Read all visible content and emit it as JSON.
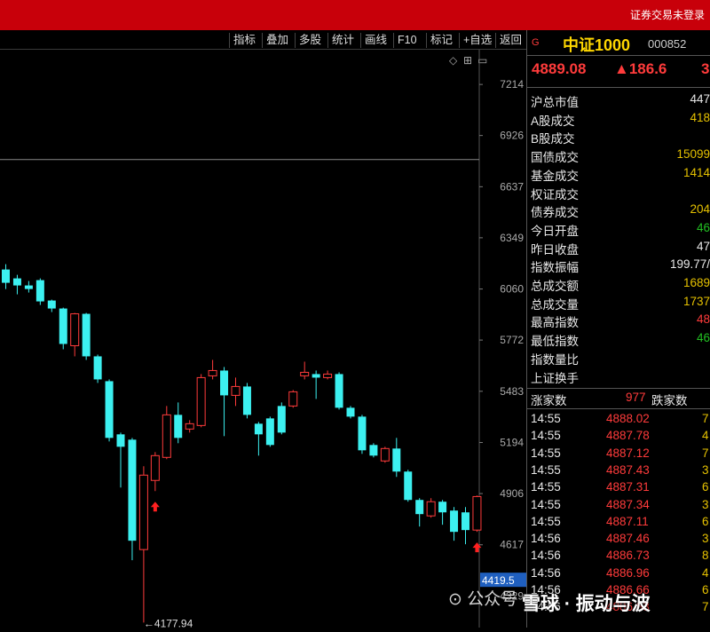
{
  "topbar": {
    "status_text": "证券交易未登录"
  },
  "toolbar": {
    "buttons": [
      "指标",
      "叠加",
      "多股",
      "统计",
      "画线",
      "F10",
      "标记",
      "+自选",
      "返回"
    ]
  },
  "chart_data": {
    "type": "candlestick",
    "y_ticks": [
      7214,
      6926,
      6637,
      6349,
      6060,
      5772,
      5483,
      5194,
      4906,
      4617,
      4329
    ],
    "ylim": [
      4150,
      7410
    ],
    "current_price_label": "4419.5",
    "min_annotation": "←4177.94",
    "reference_line": 6790,
    "candles": [
      {
        "o": 6170,
        "c": 6095,
        "h": 6200,
        "l": 6060
      },
      {
        "o": 6120,
        "c": 6080,
        "h": 6140,
        "l": 6030
      },
      {
        "o": 6080,
        "c": 6060,
        "h": 6105,
        "l": 6040
      },
      {
        "o": 6110,
        "c": 5990,
        "h": 6120,
        "l": 5970
      },
      {
        "o": 5995,
        "c": 5950,
        "h": 6000,
        "l": 5930
      },
      {
        "o": 5950,
        "c": 5750,
        "h": 5955,
        "l": 5720
      },
      {
        "o": 5740,
        "c": 5920,
        "h": 5925,
        "l": 5680
      },
      {
        "o": 5920,
        "c": 5680,
        "h": 5925,
        "l": 5660
      },
      {
        "o": 5680,
        "c": 5550,
        "h": 5690,
        "l": 5530
      },
      {
        "o": 5540,
        "c": 5220,
        "h": 5550,
        "l": 5200
      },
      {
        "o": 5240,
        "c": 5170,
        "h": 5250,
        "l": 4940
      },
      {
        "o": 5210,
        "c": 4640,
        "h": 5220,
        "l": 4530
      },
      {
        "o": 4590,
        "c": 5010,
        "h": 5060,
        "l": 4178
      },
      {
        "o": 4980,
        "c": 5120,
        "h": 5140,
        "l": 4920
      },
      {
        "o": 5110,
        "c": 5350,
        "h": 5400,
        "l": 5100
      },
      {
        "o": 5350,
        "c": 5220,
        "h": 5420,
        "l": 5190
      },
      {
        "o": 5270,
        "c": 5300,
        "h": 5320,
        "l": 5250
      },
      {
        "o": 5290,
        "c": 5560,
        "h": 5580,
        "l": 5280
      },
      {
        "o": 5570,
        "c": 5600,
        "h": 5660,
        "l": 5550
      },
      {
        "o": 5600,
        "c": 5460,
        "h": 5620,
        "l": 5230
      },
      {
        "o": 5460,
        "c": 5510,
        "h": 5560,
        "l": 5400
      },
      {
        "o": 5510,
        "c": 5350,
        "h": 5530,
        "l": 5330
      },
      {
        "o": 5300,
        "c": 5240,
        "h": 5310,
        "l": 5120
      },
      {
        "o": 5330,
        "c": 5180,
        "h": 5340,
        "l": 5170
      },
      {
        "o": 5400,
        "c": 5250,
        "h": 5420,
        "l": 5240
      },
      {
        "o": 5400,
        "c": 5480,
        "h": 5490,
        "l": 5390
      },
      {
        "o": 5570,
        "c": 5590,
        "h": 5650,
        "l": 5550
      },
      {
        "o": 5580,
        "c": 5560,
        "h": 5600,
        "l": 5440
      },
      {
        "o": 5560,
        "c": 5580,
        "h": 5600,
        "l": 5550
      },
      {
        "o": 5580,
        "c": 5390,
        "h": 5590,
        "l": 5380
      },
      {
        "o": 5390,
        "c": 5340,
        "h": 5400,
        "l": 5330
      },
      {
        "o": 5340,
        "c": 5150,
        "h": 5350,
        "l": 5130
      },
      {
        "o": 5180,
        "c": 5120,
        "h": 5190,
        "l": 5110
      },
      {
        "o": 5090,
        "c": 5160,
        "h": 5170,
        "l": 5080
      },
      {
        "o": 5160,
        "c": 5030,
        "h": 5220,
        "l": 5000
      },
      {
        "o": 5030,
        "c": 4870,
        "h": 5040,
        "l": 4860
      },
      {
        "o": 4870,
        "c": 4790,
        "h": 4880,
        "l": 4720
      },
      {
        "o": 4780,
        "c": 4860,
        "h": 4880,
        "l": 4770
      },
      {
        "o": 4860,
        "c": 4800,
        "h": 4870,
        "l": 4730
      },
      {
        "o": 4810,
        "c": 4690,
        "h": 4830,
        "l": 4640
      },
      {
        "o": 4800,
        "c": 4700,
        "h": 4830,
        "l": 4620
      },
      {
        "o": 4700,
        "c": 4889,
        "h": 4895,
        "l": 4690
      }
    ],
    "markers": [
      13,
      41
    ]
  },
  "quote": {
    "flag": "G",
    "name": "中证1000",
    "code": "000852",
    "price": "4889.08",
    "change": "▲186.6",
    "pct": "3",
    "stats": [
      {
        "label": "沪总市值",
        "value": "447",
        "color": "white"
      },
      {
        "label": "A股成交",
        "value": "418",
        "color": "yellow"
      },
      {
        "label": "B股成交",
        "value": "",
        "color": "yellow"
      },
      {
        "label": "国债成交",
        "value": "15099",
        "color": "yellow"
      },
      {
        "label": "基金成交",
        "value": "1414",
        "color": "yellow"
      },
      {
        "label": "权证成交",
        "value": "",
        "color": "yellow"
      },
      {
        "label": "债券成交",
        "value": "204",
        "color": "yellow"
      },
      {
        "label": "今日开盘",
        "value": "46",
        "color": "green"
      },
      {
        "label": "昨日收盘",
        "value": "47",
        "color": "white"
      },
      {
        "label": "指数振幅",
        "value": "199.77/",
        "color": "white"
      },
      {
        "label": "总成交额",
        "value": "1689",
        "color": "yellow"
      },
      {
        "label": "总成交量",
        "value": "1737",
        "color": "yellow"
      },
      {
        "label": "最高指数",
        "value": "48",
        "color": "red"
      },
      {
        "label": "最低指数",
        "value": "46",
        "color": "green"
      },
      {
        "label": "指数量比",
        "value": "",
        "color": "white"
      },
      {
        "label": "上证换手",
        "value": "",
        "color": "white"
      }
    ],
    "updown": {
      "up_label": "涨家数",
      "up_value": "977",
      "down_label": "跌家数"
    },
    "ticks": [
      {
        "time": "14:55",
        "price": "4888.02",
        "vol": "7"
      },
      {
        "time": "14:55",
        "price": "4887.78",
        "vol": "4"
      },
      {
        "time": "14:55",
        "price": "4887.12",
        "vol": "7"
      },
      {
        "time": "14:55",
        "price": "4887.43",
        "vol": "3"
      },
      {
        "time": "14:55",
        "price": "4887.31",
        "vol": "6"
      },
      {
        "time": "14:55",
        "price": "4887.34",
        "vol": "3"
      },
      {
        "time": "14:55",
        "price": "4887.11",
        "vol": "6"
      },
      {
        "time": "14:56",
        "price": "4887.46",
        "vol": "3"
      },
      {
        "time": "14:56",
        "price": "4886.73",
        "vol": "8"
      },
      {
        "time": "14:56",
        "price": "4886.96",
        "vol": "4"
      },
      {
        "time": "14:56",
        "price": "4886.66",
        "vol": "6"
      },
      {
        "time": "14:56",
        "price": "4886.83",
        "vol": "7"
      }
    ]
  },
  "watermark": {
    "wechat": "公众号",
    "xueqiu": "雪球 · 振动与波"
  }
}
